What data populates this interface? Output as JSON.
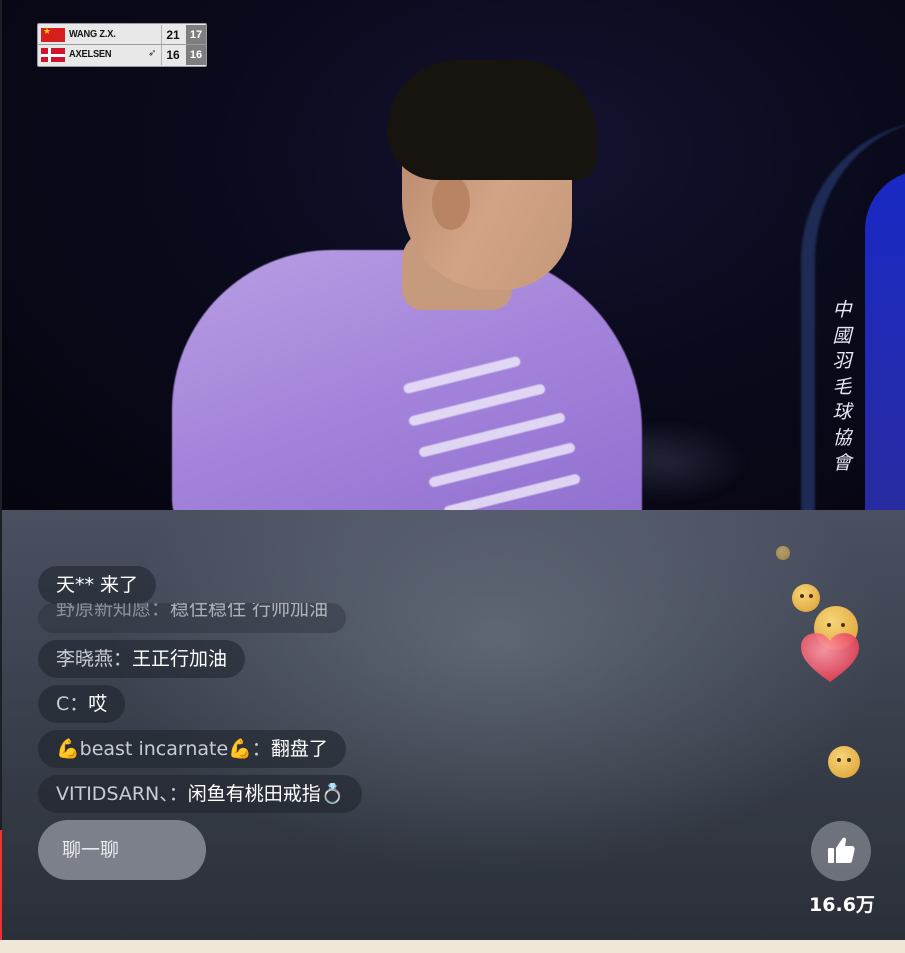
{
  "scoreboard": {
    "players": [
      {
        "name": "WANG Z.X.",
        "game_score": "21",
        "point_score": "17",
        "flag": "china-flag-icon"
      },
      {
        "name": "AXELSEN",
        "game_score": "16",
        "point_score": "16",
        "flag": "denmark-flag-icon",
        "serving": true
      }
    ]
  },
  "watermark": {
    "chars": [
      "中",
      "國",
      "羽",
      "毛",
      "球",
      "協",
      "會"
    ]
  },
  "chat": {
    "entry_notice": "天** 来了",
    "faded_message": {
      "name": "野原新知愿：",
      "text": "稳住稳住 行帅加油"
    },
    "messages": [
      {
        "name": "李晓燕：",
        "text": "王正行加油"
      },
      {
        "name": "C：",
        "text": "哎"
      },
      {
        "name": "💪beast incarnate💪：",
        "text": "翻盘了"
      },
      {
        "name": "VITIDSARN、：",
        "text": "闲鱼有桃田戒指💍"
      }
    ],
    "input_placeholder": "聊一聊"
  },
  "like": {
    "count": "16.6万",
    "icon": "thumbs-up-icon"
  },
  "colors": {
    "chat_bubble": "#1e222c",
    "like_button": "#787c86",
    "score_prev_bg": "#7e7e7e"
  }
}
